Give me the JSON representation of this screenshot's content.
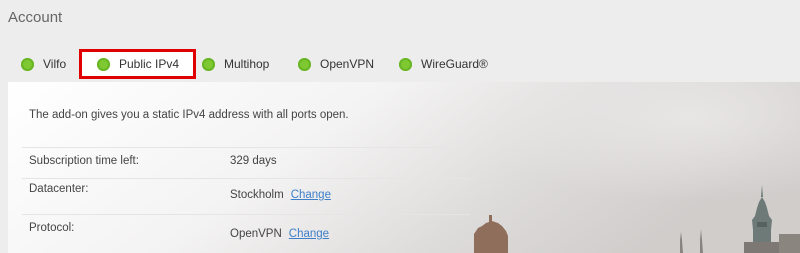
{
  "page": {
    "title": "Account"
  },
  "tabs": [
    {
      "label": "Vilfo"
    },
    {
      "label": "Public IPv4"
    },
    {
      "label": "Multihop"
    },
    {
      "label": "OpenVPN"
    },
    {
      "label": "WireGuard®"
    }
  ],
  "panel": {
    "description": "The add-on gives you a static IPv4 address with all ports open.",
    "rows": [
      {
        "label": "Subscription time left:",
        "value": "329 days"
      },
      {
        "label": "Datacenter:",
        "value": "Stockholm",
        "action": "Change"
      },
      {
        "label": "Protocol:",
        "value": "OpenVPN",
        "action": "Change"
      }
    ]
  },
  "colors": {
    "status_dot": "#7ec832",
    "highlight_border": "#e00000",
    "link": "#3d7fc9"
  }
}
